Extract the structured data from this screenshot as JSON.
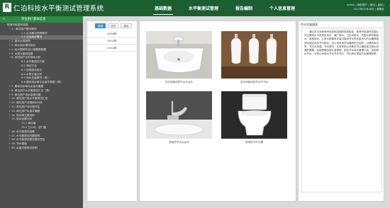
{
  "header": {
    "logo_letter": "R",
    "title": "仁泊科技水平衡测试管理系统",
    "nav": [
      "基础数据",
      "水平衡测试管理",
      "报告编制",
      "个人信息管理"
    ],
    "user_line1": "admin | 我的账户 | 退出 | 返回 |",
    "user_line2": "2017年07月28日 | 星期五"
  },
  "sidebar": {
    "header": "单位用户基本信息",
    "collapse_arrow": "«",
    "items": [
      {
        "mk": "−",
        "label": "珠海市信息科技园"
      },
      {
        "mk": "−",
        "label": "1、单位用户基本情况"
      },
      {
        "mk": "",
        "label": "1.1 企业概况说明情况"
      },
      {
        "mk": "",
        "label": "1.2 企业用水情况"
      },
      {
        "mk": "+",
        "label": "2. 用水水源说明"
      },
      {
        "mk": "+",
        "label": "3. 排水用水情况统计"
      },
      {
        "mk": "+",
        "label": "4. 给水管网布及计量器具配置"
      },
      {
        "mk": "+",
        "label": "5. 水表计量网络图"
      },
      {
        "mk": "−",
        "label": "6. 测试用户计时间水分析"
      },
      {
        "mk": "",
        "label": "6.1 水平衡测试方案"
      },
      {
        "mk": "",
        "label": "6.2 测试方法"
      },
      {
        "mk": "",
        "label": "6.3 现场测试统计"
      },
      {
        "mk": "",
        "label": "6.4 水表计量分析"
      },
      {
        "mk": "",
        "label": "6.5 用水总量情况（表）"
      },
      {
        "mk": "",
        "label": "6.6 基本用水单元水量平衡图（表）"
      },
      {
        "mk": "+",
        "label": "7. 基本用水单元水量平衡图"
      },
      {
        "mk": "+",
        "label": "8. 单位用户水平衡测试汇总（表）"
      },
      {
        "mk": "+",
        "label": "9. 单位用户用水量现时图"
      },
      {
        "mk": "+",
        "label": "10. 单位用户用水平衡测试汇总"
      },
      {
        "mk": "+",
        "label": "11. 单位用户合理用水分析"
      },
      {
        "mk": "+",
        "label": "12. 单位用户评价规评估"
      },
      {
        "mk": "+",
        "label": "13. 单位用户水量平衡图"
      },
      {
        "mk": "+",
        "label": "14. 用水单元具材料"
      },
      {
        "mk": "−",
        "label": "15. 用水定额分析"
      },
      {
        "mk": "",
        "label": "15.1 单位值"
      },
      {
        "mk": "",
        "label": "15.2 日人均、部门值"
      },
      {
        "mk": "+",
        "label": "16. 水平衡测试结果"
      },
      {
        "mk": "+",
        "label": "17. 水平衡测试问题说明"
      },
      {
        "mk": "+",
        "label": "18. 水平衡测试建议建议意见"
      },
      {
        "mk": "+",
        "label": "19. 节水措施"
      },
      {
        "mk": "+",
        "label": "20. 水量平衡测试说明"
      }
    ]
  },
  "tabs": [
    "新增",
    "修改",
    "删除"
  ],
  "years": [
    "2016年",
    "2015年",
    "2014年"
  ],
  "gallery": [
    {
      "caption": "洗手间使用的节水水龙头"
    },
    {
      "caption": "洗手间使用的节水节节水"
    },
    {
      "caption": "使用的节水水龙头"
    },
    {
      "caption": "使用的节水马桶"
    }
  ],
  "description": {
    "title": "节水实施描述",
    "body": "通过本次对珠海市信息科技园的现场检查，珠海市信息科技园公司主要采水为市政自来水，偏厂用水、卫生间用水、洗脸水和车辆用水，各种用水，公司水表使用计量可靠用节水的作用也为节水器具做到全面应用水节水规定。该公司采用节水器具的已经有，以降低用水率，节约水资源。节水情况，总体来说公司基本可以满足各方面水资源的需要。后续需要加强计量管理，制定节水用水管理计划，控制用水节水，日常公司用水节水节约节约，节约用水提高节水管理效率。"
  },
  "colors": {
    "header": "#1b5e30",
    "sidebar_header": "#2e8b44",
    "sidebar": "#4e4e4e",
    "tab_active": "#3b8fd0"
  }
}
